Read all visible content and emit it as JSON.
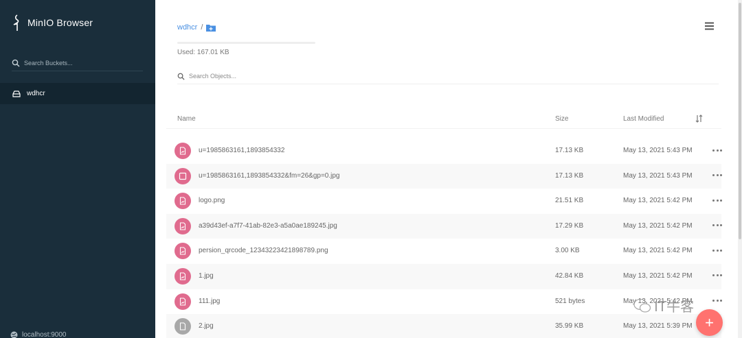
{
  "colors": {
    "sidebar_bg": "#1a2e3b",
    "active_bucket_bg": "#132530",
    "accent": "#4a90e2",
    "file_icon": "#e06b8e",
    "file_icon_other": "#a8a8a8",
    "fab": "#ff726f"
  },
  "sidebar": {
    "brand": "MinIO Browser",
    "search_placeholder": "Search Buckets...",
    "buckets": [
      {
        "name": "wdhcr",
        "icon": "hard-drive-icon"
      }
    ],
    "host": "localhost:9000"
  },
  "main": {
    "breadcrumb": {
      "bucket": "wdhcr",
      "separator": "/"
    },
    "usage": {
      "used_text": "Used: 167.01 KB",
      "fraction": 0.0
    },
    "search_placeholder": "Search Objects...",
    "columns": {
      "name": "Name",
      "size": "Size",
      "last_modified": "Last Modified"
    },
    "files": [
      {
        "name": "u=1985863161,1893854332",
        "size": "17.13 KB",
        "modified": "May 13, 2021 5:43 PM",
        "icon": "image-file-icon"
      },
      {
        "name": "u=1985863161,1893854332&fm=26&gp=0.jpg",
        "size": "17.13 KB",
        "modified": "May 13, 2021 5:43 PM",
        "icon": "checkbox-icon"
      },
      {
        "name": "logo.png",
        "size": "21.51 KB",
        "modified": "May 13, 2021 5:42 PM",
        "icon": "image-file-icon"
      },
      {
        "name": "a39d43ef-a7f7-41ab-82e3-a5a0ae189245.jpg",
        "size": "17.29 KB",
        "modified": "May 13, 2021 5:42 PM",
        "icon": "image-file-icon"
      },
      {
        "name": "persion_qrcode_12343223421898789.png",
        "size": "3.00 KB",
        "modified": "May 13, 2021 5:42 PM",
        "icon": "image-file-icon"
      },
      {
        "name": "1.jpg",
        "size": "42.84 KB",
        "modified": "May 13, 2021 5:42 PM",
        "icon": "image-file-icon"
      },
      {
        "name": "111.jpg",
        "size": "521 bytes",
        "modified": "May 13, 2021 5:42 PM",
        "icon": "image-file-icon"
      },
      {
        "name": "2.jpg",
        "size": "35.99 KB",
        "modified": "May 13, 2021 5:39 PM",
        "icon": "file-icon"
      }
    ]
  },
  "fab": {
    "label": "+"
  },
  "watermark": {
    "text": "IT牛客"
  }
}
